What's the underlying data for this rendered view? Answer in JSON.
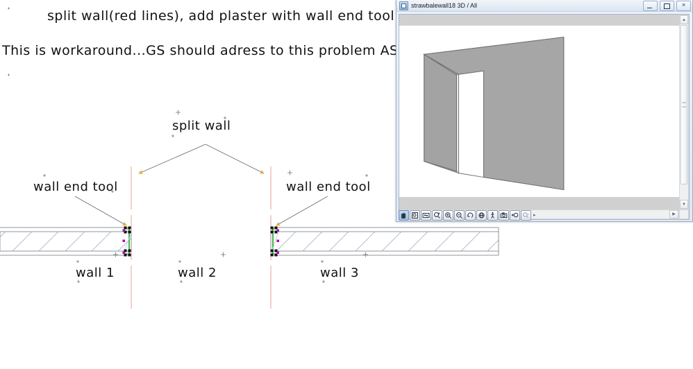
{
  "drawing": {
    "headline_1": "split wall(red lines), add plaster with wall end tool",
    "headline_2": "This is workaround...GS should adress to this problem ASA",
    "label_split_wall": "split wall",
    "label_wall_end_tool_left": "wall end tool",
    "label_wall_end_tool_right": "wall end tool",
    "label_wall_1": "wall 1",
    "label_wall_2": "wall 2",
    "label_wall_3": "wall 3"
  },
  "colors": {
    "split_line": "#e8a9a0",
    "arrow": "#e8a933",
    "leader": "#6b6b7a",
    "hatch": "#b9bcc4",
    "wall_outline": "#8f949c",
    "grip_black": "#101010",
    "grip_magenta": "#b400b4",
    "selection_green": "#19a319",
    "window_chrome": "#dbe5f1",
    "viewport_band": "#d0d0d0",
    "model_face_light": "#a8a8a8",
    "model_face_dark": "#9a9a9a",
    "model_edge": "#6e6e6e"
  },
  "window3d": {
    "title": "strawbalewall18 3D / All",
    "title_icon": "app-window-icon",
    "buttons": {
      "minimize": "minimize-button",
      "maximize": "maximize-button",
      "close": "close-button",
      "close_glyph": "✕"
    },
    "scrollbars": {
      "up_glyph": "▲",
      "down_glyph": "▼",
      "left_glyph": "◀",
      "right_glyph": "▶"
    },
    "toolbar": [
      {
        "name": "pan-hand-tool",
        "selected": true
      },
      {
        "name": "zoom-window-tool",
        "selected": false
      },
      {
        "name": "fit-in-window-tool",
        "selected": false
      },
      {
        "name": "zoom-selection-tool",
        "selected": false
      },
      {
        "name": "zoom-in-tool",
        "selected": false
      },
      {
        "name": "zoom-out-tool",
        "selected": false
      },
      {
        "name": "orbit-tool",
        "selected": false
      },
      {
        "name": "globe-rotate-tool",
        "selected": false
      },
      {
        "name": "walk-through-tool",
        "selected": false
      },
      {
        "name": "camera-tool",
        "selected": false
      },
      {
        "name": "previous-zoom-tool",
        "selected": false
      },
      {
        "name": "zoom-dropdown-tool",
        "selected": false
      }
    ]
  },
  "model": {
    "description": "3D straw bale wall panel with door opening",
    "opening": "door-opening"
  }
}
